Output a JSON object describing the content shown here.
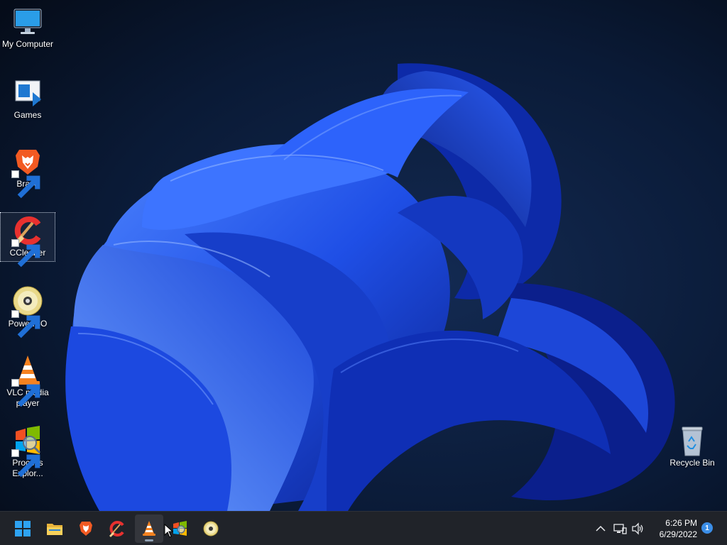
{
  "desktop": {
    "icons": [
      {
        "name": "my-computer",
        "label": "My Computer"
      },
      {
        "name": "games",
        "label": "Games"
      },
      {
        "name": "brave",
        "label": "Brave"
      },
      {
        "name": "ccleaner",
        "label": "CCleaner"
      },
      {
        "name": "poweriso",
        "label": "PowerISO"
      },
      {
        "name": "vlc",
        "label": "VLC media player"
      },
      {
        "name": "process-explorer",
        "label": "Process Explor..."
      },
      {
        "name": "recycle-bin",
        "label": "Recycle Bin"
      }
    ],
    "selected_icon": "CCleaner"
  },
  "taskbar": {
    "buttons": [
      {
        "name": "start",
        "icon": "windows-logo-icon"
      },
      {
        "name": "file-explorer",
        "icon": "folder-icon"
      },
      {
        "name": "brave",
        "icon": "brave-lion-icon"
      },
      {
        "name": "ccleaner",
        "icon": "ccleaner-icon"
      },
      {
        "name": "vlc",
        "icon": "vlc-cone-icon",
        "active": true
      },
      {
        "name": "process-explorer",
        "icon": "process-explorer-icon"
      },
      {
        "name": "poweriso",
        "icon": "poweriso-disc-icon"
      }
    ],
    "tray": {
      "icons": [
        "chevron-up-icon",
        "network-icon",
        "volume-icon"
      ],
      "time": "6:26 PM",
      "date": "6/29/2022",
      "notification_count": "1"
    }
  },
  "colors": {
    "wallpaper_bg": "#06101f",
    "bloom_blue": "#1e4be0",
    "taskbar": "#202329",
    "accent": "#3b8ee8"
  }
}
